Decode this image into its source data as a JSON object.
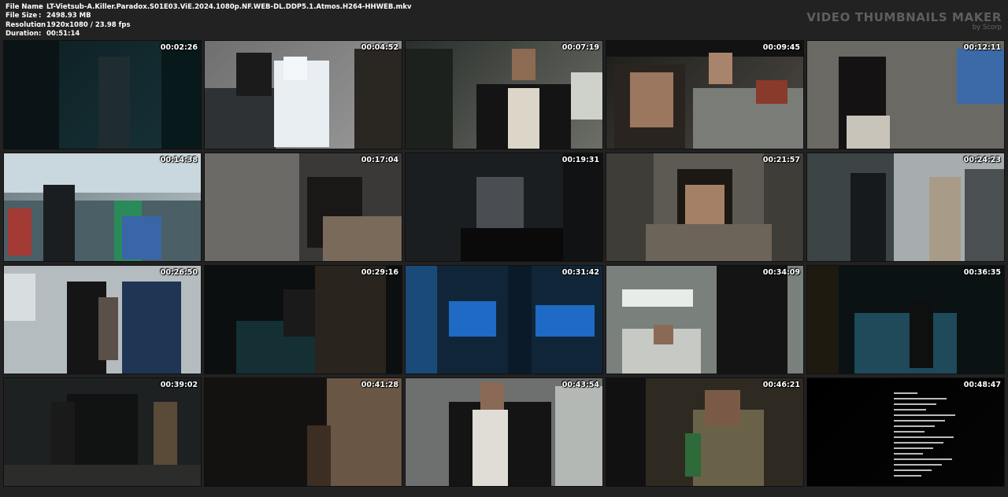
{
  "file_info": {
    "rows": [
      {
        "label": "File Name",
        "value": "LT-Vietsub-A.Killer.Paradox.S01E03.ViE.2024.1080p.NF.WEB-DL.DDP5.1.Atmos.H264-HHWEB.mkv"
      },
      {
        "label": "File Size",
        "value": "2498.93 MB"
      },
      {
        "label": "Resolution",
        "value": "1920x1080 / 23.98 fps"
      },
      {
        "label": "Duration",
        "value": "00:51:14"
      }
    ],
    "separator": ":"
  },
  "brand": {
    "title": "VIDEO THUMBNAILS MAKER",
    "subtitle": "by Scorp"
  },
  "thumbnails": [
    {
      "time": "00:02:26",
      "colors": [
        "#0d1f22",
        "#173238"
      ]
    },
    {
      "time": "00:04:52",
      "colors": [
        "#6f6f6f",
        "#9a9a9a"
      ]
    },
    {
      "time": "00:07:19",
      "colors": [
        "#2b2f2c",
        "#6c6f67"
      ]
    },
    {
      "time": "00:09:45",
      "colors": [
        "#1d1d1b",
        "#4e4a43"
      ]
    },
    {
      "time": "00:12:11",
      "colors": [
        "#4a4a46",
        "#8a8880"
      ]
    },
    {
      "time": "00:14:38",
      "colors": [
        "#6a7a80",
        "#b5c0c4"
      ]
    },
    {
      "time": "00:17:04",
      "colors": [
        "#2a2a28",
        "#5a5854"
      ]
    },
    {
      "time": "00:19:31",
      "colors": [
        "#161819",
        "#2c3134"
      ]
    },
    {
      "time": "00:21:57",
      "colors": [
        "#2f2f2b",
        "#4d4c45"
      ]
    },
    {
      "time": "00:24:23",
      "colors": [
        "#2a3133",
        "#5b6466"
      ]
    },
    {
      "time": "00:26:50",
      "colors": [
        "#3a4d5b",
        "#8b98a0"
      ]
    },
    {
      "time": "00:29:16",
      "colors": [
        "#101414",
        "#1a2a2b"
      ]
    },
    {
      "time": "00:31:42",
      "colors": [
        "#0d2a40",
        "#1c4e78"
      ]
    },
    {
      "time": "00:34:09",
      "colors": [
        "#2e3332",
        "#5e6662"
      ]
    },
    {
      "time": "00:36:35",
      "colors": [
        "#0d1516",
        "#17313a"
      ]
    },
    {
      "time": "00:39:02",
      "colors": [
        "#1a1d1e",
        "#34393a"
      ]
    },
    {
      "time": "00:41:28",
      "colors": [
        "#1e1a17",
        "#5a4a3c"
      ]
    },
    {
      "time": "00:43:54",
      "colors": [
        "#3a3e3e",
        "#8c8f8d"
      ]
    },
    {
      "time": "00:46:21",
      "colors": [
        "#1c1b17",
        "#4a3f2e"
      ]
    },
    {
      "time": "00:48:47",
      "colors": [
        "#000000",
        "#050505"
      ]
    }
  ]
}
